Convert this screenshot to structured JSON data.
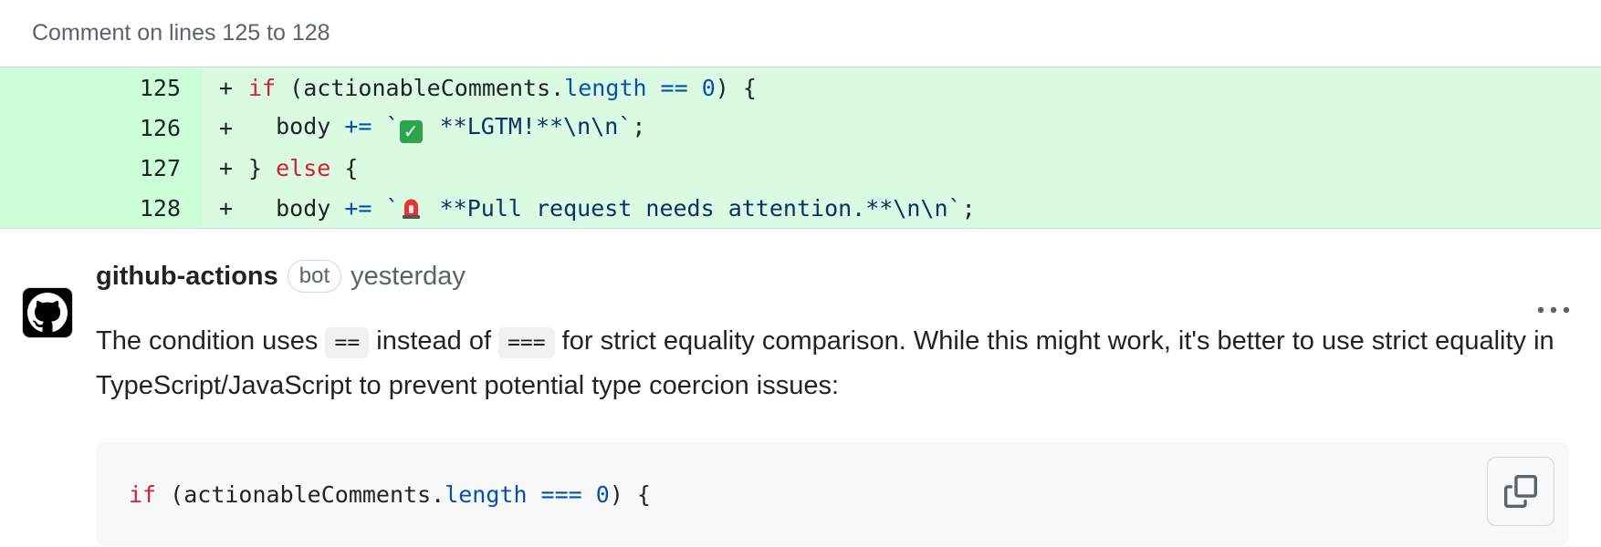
{
  "header": {
    "title": "Comment on lines 125 to 128"
  },
  "diff": {
    "lines": [
      {
        "number": "125",
        "marker": "+"
      },
      {
        "number": "126",
        "marker": "+"
      },
      {
        "number": "127",
        "marker": "+"
      },
      {
        "number": "128",
        "marker": "+"
      }
    ],
    "tokens": {
      "l125_kw": "if",
      "l125_a": " (actionableComments.",
      "l125_prop": "length",
      "l125_op": " == ",
      "l125_num": "0",
      "l125_b": ") {",
      "l126_a": "  body ",
      "l126_op": "+=",
      "l126_str1": " `",
      "l126_str2": " **LGTM!**\\n\\n`",
      "l126_b": ";",
      "l127_a": "} ",
      "l127_kw": "else",
      "l127_b": " {",
      "l128_a": "  body ",
      "l128_op": "+=",
      "l128_str1": " `",
      "l128_str2": " **Pull request needs attention.**\\n\\n`",
      "l128_b": ";"
    }
  },
  "comment": {
    "author": "github-actions",
    "badge": "bot",
    "time": "yesterday",
    "body_1": "The condition uses ",
    "code_1": "==",
    "body_2": " instead of ",
    "code_2": "===",
    "body_3": " for strict equality comparison. While this might work, it's better to use strict equality in TypeScript/JavaScript to prevent potential type coercion issues:",
    "suggestion": {
      "kw": "if",
      "a": " (actionableComments.",
      "prop": "length",
      "op": " === ",
      "num": "0",
      "b": ") {"
    }
  },
  "icons": {
    "avatar": "github-octocat-icon",
    "menu": "kebab-horizontal-icon",
    "copy": "copy-icon"
  }
}
